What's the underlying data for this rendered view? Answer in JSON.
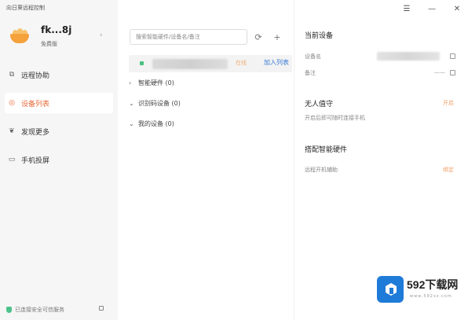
{
  "app": {
    "title": "向日葵远程控制"
  },
  "profile": {
    "username": "fk...8j",
    "membership": "免费版"
  },
  "nav": {
    "items": [
      {
        "label": "远程协助",
        "icon": "remote-assist-icon"
      },
      {
        "label": "设备列表",
        "icon": "device-list-icon",
        "active": true
      },
      {
        "label": "发现更多",
        "icon": "discover-icon"
      },
      {
        "label": "手机投屏",
        "icon": "screen-cast-icon"
      }
    ]
  },
  "bottom_status": {
    "text": "已连接安全可信服务"
  },
  "devices": {
    "search_placeholder": "搜索智能硬件/设备名/备注",
    "refresh_icon": "refresh-icon",
    "add_icon": "plus-icon",
    "current_device": {
      "status": "在线",
      "action": "加入列表"
    },
    "groups": [
      {
        "label": "智能硬件 (0)",
        "expanded": false
      },
      {
        "label": "识别码设备 (0)",
        "expanded": true
      },
      {
        "label": "我的设备 (0)",
        "expanded": true
      }
    ]
  },
  "current_device": {
    "title": "当前设备",
    "name_label": "设备名",
    "note_label": "备注",
    "note_value": "——"
  },
  "unattended": {
    "title": "无人值守",
    "toggle": "开启",
    "description": "开启后即可随时连接手机"
  },
  "smart_hardware": {
    "title": "搭配智能硬件",
    "item": "远程开机辅助",
    "action": "绑定"
  },
  "window": {
    "menu_icon": "menu-icon",
    "minimize_icon": "minimize-icon",
    "close_icon": "close-icon"
  },
  "watermark": {
    "text": "592下载网",
    "url": "www.592xz.com"
  },
  "colors": {
    "accent": "#e86a3a",
    "link": "#3a7bd5",
    "online": "#48c07f",
    "watermark": "#1f7bd8"
  }
}
